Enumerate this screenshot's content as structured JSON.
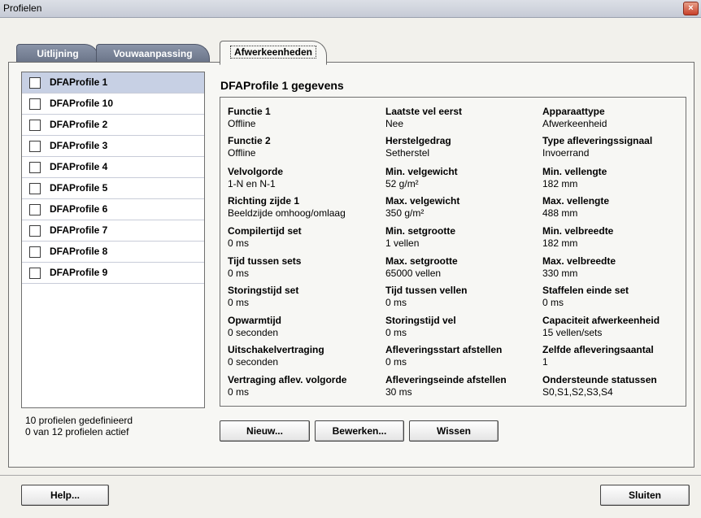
{
  "window": {
    "title": "Profielen",
    "close_glyph": "×"
  },
  "tabs": [
    {
      "label": "Uitlijning"
    },
    {
      "label": "Vouwaanpassing"
    },
    {
      "label": "Afwerkeenheden"
    }
  ],
  "profiles": [
    {
      "label": "DFAProfile 1"
    },
    {
      "label": "DFAProfile 10"
    },
    {
      "label": "DFAProfile 2"
    },
    {
      "label": "DFAProfile 3"
    },
    {
      "label": "DFAProfile 4"
    },
    {
      "label": "DFAProfile 5"
    },
    {
      "label": "DFAProfile 6"
    },
    {
      "label": "DFAProfile 7"
    },
    {
      "label": "DFAProfile 8"
    },
    {
      "label": "DFAProfile 9"
    }
  ],
  "status": {
    "defined": "10 profielen gedefinieerd",
    "active": "0 van 12 profielen actief"
  },
  "details": {
    "title": "DFAProfile 1 gegevens",
    "col1": [
      {
        "label": "Functie 1",
        "value": "Offline"
      },
      {
        "label": "Functie 2",
        "value": "Offline"
      },
      {
        "label": "Velvolgorde",
        "value": "1-N en N-1"
      },
      {
        "label": "Richting zijde 1",
        "value": "Beeldzijde omhoog/omlaag"
      },
      {
        "label": "Compilertijd set",
        "value": "0 ms"
      },
      {
        "label": "Tijd tussen sets",
        "value": "0 ms"
      },
      {
        "label": "Storingstijd set",
        "value": "0 ms"
      },
      {
        "label": "Opwarmtijd",
        "value": "0 seconden"
      },
      {
        "label": "Uitschakelvertraging",
        "value": "0 seconden"
      },
      {
        "label": "Vertraging aflev. volgorde",
        "value": "0 ms"
      }
    ],
    "col2": [
      {
        "label": "Laatste vel eerst",
        "value": "Nee"
      },
      {
        "label": "Herstelgedrag",
        "value": "Setherstel"
      },
      {
        "label": "Min. velgewicht",
        "value": "52 g/m²"
      },
      {
        "label": "Max. velgewicht",
        "value": "350 g/m²"
      },
      {
        "label": "Min. setgrootte",
        "value": "1 vellen"
      },
      {
        "label": "Max. setgrootte",
        "value": "65000 vellen"
      },
      {
        "label": "Tijd tussen vellen",
        "value": "0 ms"
      },
      {
        "label": "Storingstijd vel",
        "value": "0 ms"
      },
      {
        "label": "Afleveringsstart afstellen",
        "value": "0 ms"
      },
      {
        "label": "Afleveringseinde afstellen",
        "value": "30 ms"
      }
    ],
    "col3": [
      {
        "label": "Apparaattype",
        "value": "Afwerkeenheid"
      },
      {
        "label": "Type afleveringssignaal",
        "value": "Invoerrand"
      },
      {
        "label": "Min. vellengte",
        "value": "182 mm"
      },
      {
        "label": "Max. vellengte",
        "value": "488 mm"
      },
      {
        "label": "Min. velbreedte",
        "value": "182 mm"
      },
      {
        "label": "Max. velbreedte",
        "value": "330 mm"
      },
      {
        "label": "Staffelen einde set",
        "value": "0 ms"
      },
      {
        "label": "Capaciteit afwerkeenheid",
        "value": "15 vellen/sets"
      },
      {
        "label": "Zelfde afleveringsaantal",
        "value": "1"
      },
      {
        "label": "Ondersteunde statussen",
        "value": "S0,S1,S2,S3,S4"
      }
    ]
  },
  "buttons": {
    "new": "Nieuw...",
    "edit": "Bewerken...",
    "delete": "Wissen",
    "help": "Help...",
    "close": "Sluiten"
  }
}
